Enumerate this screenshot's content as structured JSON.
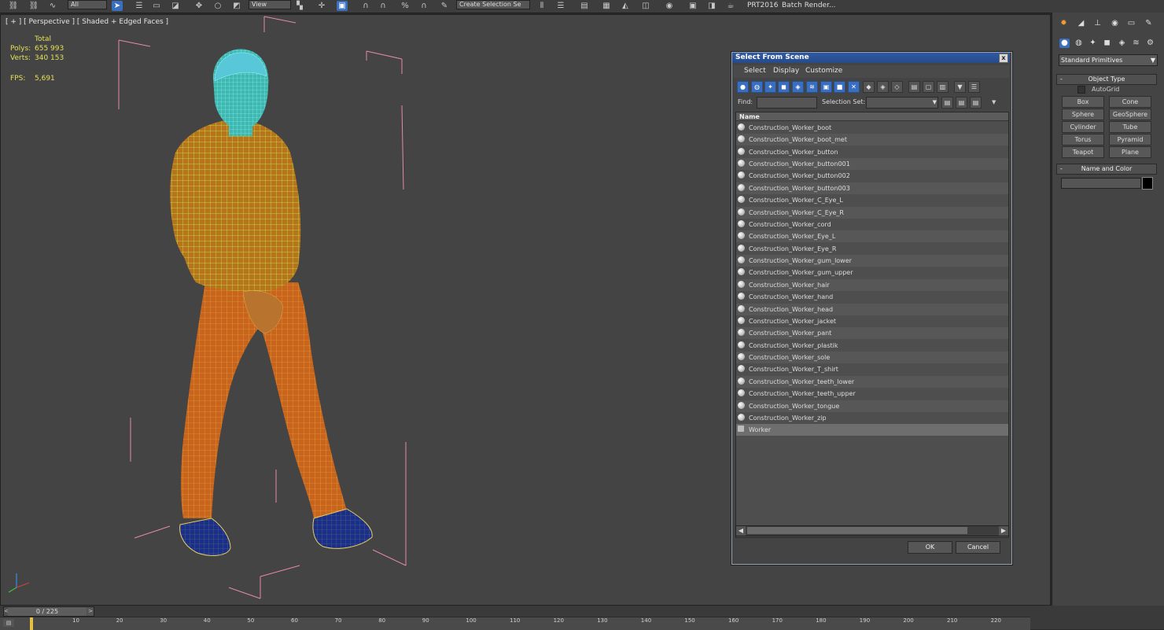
{
  "toolbar": {
    "filter_value": "All",
    "view_value": "View",
    "selection_set_placeholder": "Create Selection Se",
    "prt_label": "PRT2016",
    "batch_render_label": "Batch Render..."
  },
  "viewport": {
    "label": "[ + ] [ Perspective ] [ Shaded + Edged Faces ]",
    "stats": {
      "total_label": "Total",
      "polys_label": "Polys:",
      "polys_value": "655 993",
      "verts_label": "Verts:",
      "verts_value": "340 153",
      "fps_label": "FPS:",
      "fps_value": "5,691"
    }
  },
  "command_panel": {
    "category": "Standard Primitives",
    "object_type_title": "Object Type",
    "autogrid_label": "AutoGrid",
    "buttons": [
      "Box",
      "Cone",
      "Sphere",
      "GeoSphere",
      "Cylinder",
      "Tube",
      "Torus",
      "Pyramid",
      "Teapot",
      "Plane"
    ],
    "name_color_title": "Name and Color",
    "colors": {
      "swatch": "#000000"
    }
  },
  "timeline": {
    "frame_display": "0 / 225",
    "ticks": [
      "10",
      "20",
      "30",
      "40",
      "50",
      "60",
      "70",
      "80",
      "90",
      "100",
      "110",
      "120",
      "130",
      "140",
      "150",
      "160",
      "170",
      "180",
      "190",
      "200",
      "210",
      "220"
    ]
  },
  "dialog": {
    "title": "Select From Scene",
    "close_label": "x",
    "menu": [
      "Select",
      "Display",
      "Customize"
    ],
    "find_label": "Find:",
    "selection_set_label": "Selection Set:",
    "column_header": "Name",
    "rows": [
      "Construction_Worker_boot",
      "Construction_Worker_boot_met",
      "Construction_Worker_button",
      "Construction_Worker_button001",
      "Construction_Worker_button002",
      "Construction_Worker_button003",
      "Construction_Worker_C_Eye_L",
      "Construction_Worker_C_Eye_R",
      "Construction_Worker_cord",
      "Construction_Worker_Eye_L",
      "Construction_Worker_Eye_R",
      "Construction_Worker_gum_lower",
      "Construction_Worker_gum_upper",
      "Construction_Worker_hair",
      "Construction_Worker_hand",
      "Construction_Worker_head",
      "Construction_Worker_jacket",
      "Construction_Worker_pant",
      "Construction_Worker_plastik",
      "Construction_Worker_sole",
      "Construction_Worker_T_shirt",
      "Construction_Worker_teeth_lower",
      "Construction_Worker_teeth_upper",
      "Construction_Worker_tongue",
      "Construction_Worker_zip",
      "Worker"
    ],
    "ok_label": "OK",
    "cancel_label": "Cancel"
  }
}
